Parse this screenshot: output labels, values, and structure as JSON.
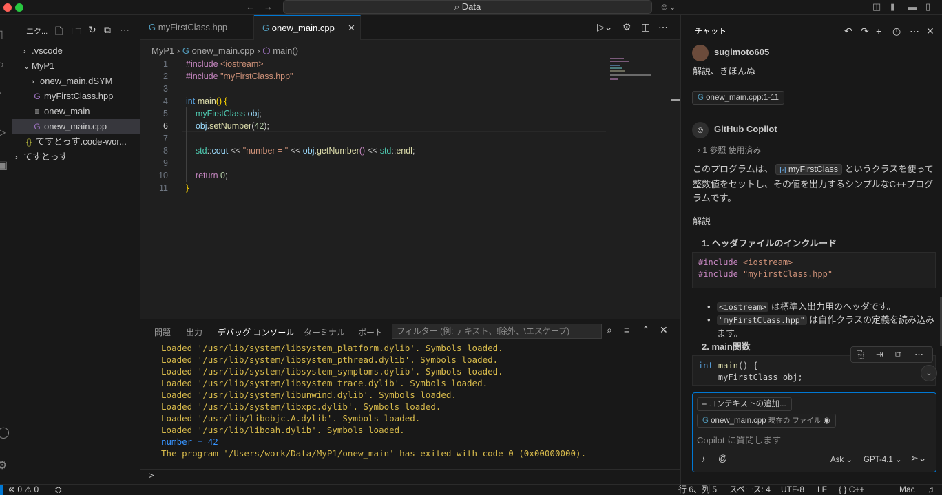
{
  "titlebar": {
    "search": "Data"
  },
  "explorer": {
    "title": "エク...",
    "items": [
      {
        "label": ".vscode",
        "kind": "folder",
        "open": false,
        "indent": 1
      },
      {
        "label": "MyP1",
        "kind": "folder",
        "open": true,
        "indent": 1
      },
      {
        "label": "onew_main.dSYM",
        "kind": "folder",
        "open": false,
        "indent": 2
      },
      {
        "label": "myFirstClass.hpp",
        "kind": "cpp",
        "indent": 2
      },
      {
        "label": "onew_main",
        "kind": "text",
        "indent": 2
      },
      {
        "label": "onew_main.cpp",
        "kind": "cpp",
        "indent": 2,
        "selected": true
      },
      {
        "label": "てすとっす.code-wor...",
        "kind": "json",
        "indent": 1
      },
      {
        "label": "てすとっす",
        "kind": "folder",
        "open": false,
        "indent": 0
      }
    ]
  },
  "editor": {
    "tabs": [
      {
        "label": "myFirstClass.hpp",
        "active": false
      },
      {
        "label": "onew_main.cpp",
        "active": true
      }
    ],
    "breadcrumb": {
      "folder": "MyP1",
      "file": "onew_main.cpp",
      "symbol": "main()"
    },
    "line_numbers": [
      "1",
      "2",
      "3",
      "4",
      "5",
      "6",
      "7",
      "8",
      "9",
      "10",
      "11"
    ],
    "current_line": "6"
  },
  "panel": {
    "tabs": [
      "問題",
      "出力",
      "デバッグ コンソール",
      "ターミナル",
      "ポート"
    ],
    "active_tab": "デバッグ コンソール",
    "filter_placeholder": "フィルター (例: テキスト、!除外、\\エスケープ)",
    "output": [
      "Loaded '/usr/lib/system/libsystem_platform.dylib'. Symbols loaded.",
      "Loaded '/usr/lib/system/libsystem_pthread.dylib'. Symbols loaded.",
      "Loaded '/usr/lib/system/libsystem_symptoms.dylib'. Symbols loaded.",
      "Loaded '/usr/lib/system/libsystem_trace.dylib'. Symbols loaded.",
      "Loaded '/usr/lib/system/libunwind.dylib'. Symbols loaded.",
      "Loaded '/usr/lib/system/libxpc.dylib'. Symbols loaded.",
      "Loaded '/usr/lib/libobjc.A.dylib'. Symbols loaded.",
      "Loaded '/usr/lib/liboah.dylib'. Symbols loaded.",
      "number = 42",
      "The program '/Users/work/Data/MyP1/onew_main' has exited with code 0 (0x00000000)."
    ],
    "prompt": ">"
  },
  "chat": {
    "title": "チャット",
    "user": "sugimoto605",
    "user_message": "解説、きぼんぬ",
    "context_chip": "onew_main.cpp:1-11",
    "assistant": "GitHub Copilot",
    "refs": "1 参照 使用済み",
    "intro_a": "このプログラムは、",
    "intro_class": "myFirstClass",
    "intro_b": "というクラスを使って整数値をセットし、その値を出力するシンプルなC++プログラムです。",
    "section": "解説",
    "item1": "1. ヘッダファイルのインクルード",
    "code1_l1_a": "#include ",
    "code1_l1_b": "<iostream>",
    "code1_l2_a": "#include ",
    "code1_l2_b": "\"myFirstClass.hpp\"",
    "bullet1_code": "<iostream>",
    "bullet1_text": "は標準入出力用のヘッダです。",
    "bullet2_code": "\"myFirstClass.hpp\"",
    "bullet2_text": "は自作クラスの定義を読み込みます。",
    "item2": "2. main関数",
    "input": {
      "add_context": "コンテキストの追加...",
      "file_chip": "onew_main.cpp",
      "file_chip_note": "現在の ファイル",
      "placeholder": "Copilot に質問します",
      "mode": "Ask",
      "model": "GPT-4.1"
    }
  },
  "statusbar": {
    "errors": "0",
    "warnings": "0",
    "position": "行 6、列 5",
    "spaces": "スペース: 4",
    "encoding": "UTF-8",
    "eol": "LF",
    "language": "C++",
    "platform": "Mac"
  },
  "colors": {
    "accent": "#0078d4",
    "debug_output": "#d7ba4b",
    "program_output": "#3794ff"
  }
}
